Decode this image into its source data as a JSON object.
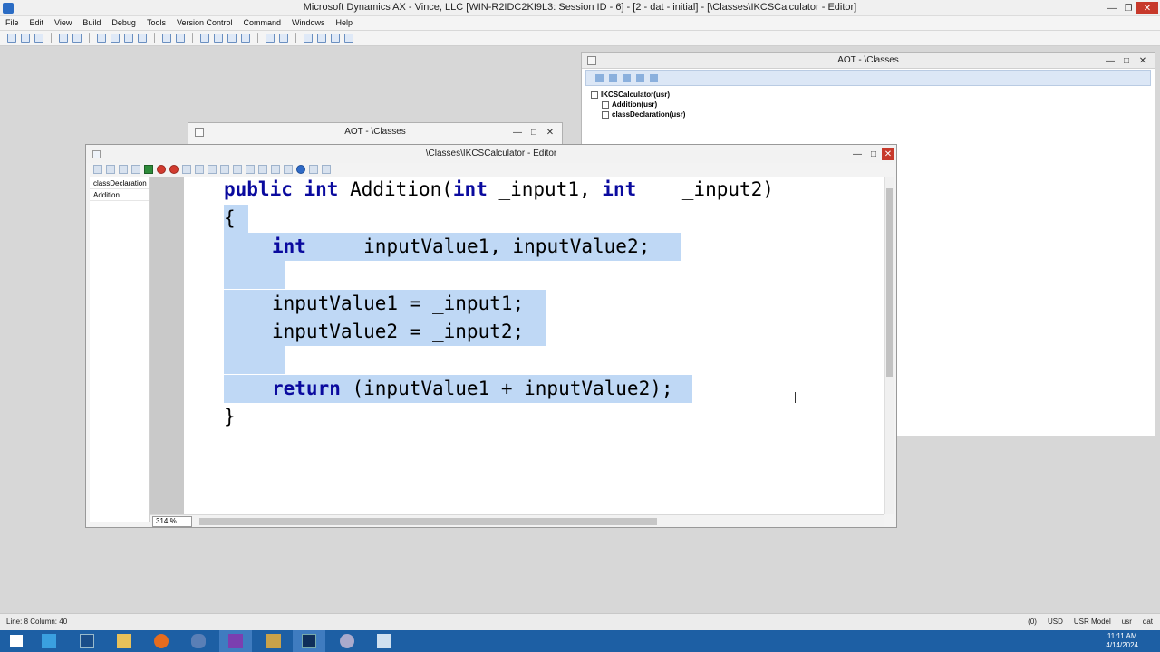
{
  "app": {
    "title": "Microsoft Dynamics AX - Vince, LLC [WIN-R2IDC2KI9L3: Session ID - 6] -  [2 - dat - initial] - [\\Classes\\IKCSCalculator - Editor]"
  },
  "menu": [
    "File",
    "Edit",
    "View",
    "Build",
    "Debug",
    "Tools",
    "Version Control",
    "Command",
    "Windows",
    "Help"
  ],
  "aot_right": {
    "title": "AOT - \\Classes",
    "tree": {
      "root": "IKCSCalculator(usr)",
      "children": [
        "Addition(usr)",
        "classDeclaration(usr)"
      ]
    }
  },
  "aot_back": {
    "title": "AOT - \\Classes"
  },
  "editor": {
    "title": "\\Classes\\IKCSCalculator - Editor",
    "methods": [
      "classDeclaration",
      "Addition"
    ],
    "zoom": "314 %",
    "code": {
      "l1_kw1": "public",
      "l1_kw2": "int",
      "l1_name": "Addition(",
      "l1_kw3": "int",
      "l1_p1": " _input1, ",
      "l1_kw4": "int",
      "l1_p2": "    _input2)",
      "l2": "{",
      "l3_kw": "int",
      "l3_rest": "     inputValue1, inputValue2;",
      "l5": "inputValue1 = _input1;",
      "l6": "inputValue2 = _input2;",
      "l8_kw": "return",
      "l8_rest": " (inputValue1 + inputValue2);",
      "l9": "}"
    }
  },
  "statusbar": {
    "position": "Line: 8 Column: 40",
    "notifications": "(0)",
    "currency": "USD",
    "layer": "USR Model",
    "user": "usr",
    "company": "dat"
  },
  "taskbar": {
    "time": "11:11 AM",
    "date": "4/14/2024"
  },
  "colors": {
    "keyword": "#0a0a9e",
    "selection": "#bfd8f5",
    "taskbar": "#1d5fa4"
  }
}
